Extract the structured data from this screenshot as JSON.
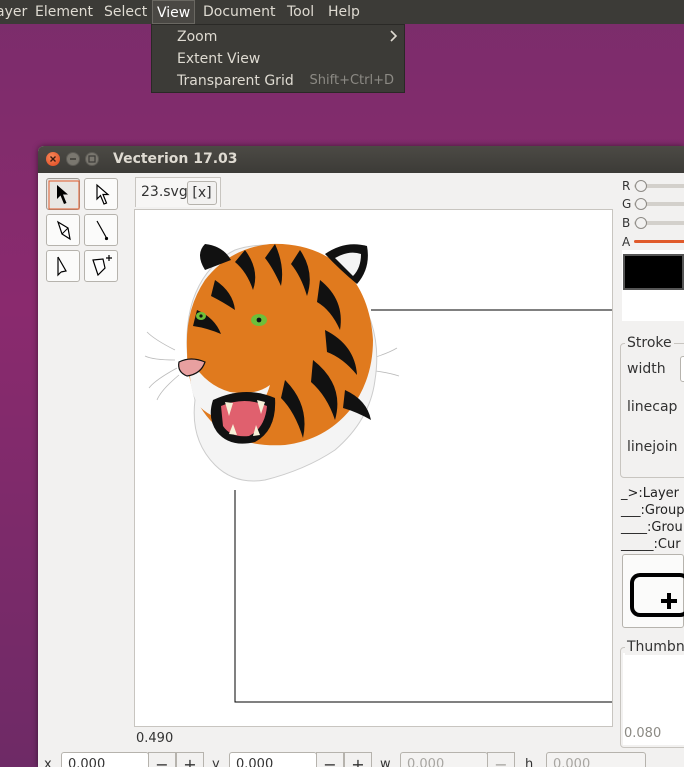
{
  "menubar": {
    "items": [
      "ayer",
      "Element",
      "Select",
      "View",
      "Document",
      "Tool",
      "Help"
    ],
    "active": "View"
  },
  "view_menu": {
    "items": [
      {
        "label": "Zoom",
        "accel": "",
        "submenu": true
      },
      {
        "label": "Extent View",
        "accel": ""
      },
      {
        "label": "Transparent Grid",
        "accel": "Shift+Ctrl+D"
      }
    ]
  },
  "window": {
    "title": "Vecterion 17.03"
  },
  "tabs": [
    {
      "label": "23.svg",
      "close_label": "[x]"
    }
  ],
  "canvas": {
    "zoom": "0.490"
  },
  "bottom": {
    "x_label": "x",
    "x_value": "0.000",
    "y_label": "y",
    "y_value": "0.000",
    "w_label": "w",
    "w_value": "0.000",
    "h_label": "h",
    "h_value": "0.000",
    "minus": "−",
    "plus": "+"
  },
  "color_panel": {
    "r_label": "R",
    "g_label": "G",
    "b_label": "B",
    "a_label": "A",
    "swatch_color": "#000000",
    "alpha_color": "#e05a2b"
  },
  "stroke_panel": {
    "title": "Stroke",
    "width_label": "width",
    "linecap_label": "linecap",
    "linejoin_label": "linejoin"
  },
  "layers": [
    "_>:Layer",
    "___:Group",
    "____:Grou",
    "_____:Cur"
  ],
  "thumbnail": {
    "title": "Thumbn",
    "value": "0.080"
  },
  "icons": [
    "close-icon",
    "minimize-icon",
    "maximize-icon",
    "select-arrow-icon",
    "node-arrow-icon",
    "pen-tool-icon",
    "line-tool-icon",
    "add-anchor-icon",
    "add-node-icon",
    "add-layer-icon",
    "chevron-right-icon"
  ]
}
